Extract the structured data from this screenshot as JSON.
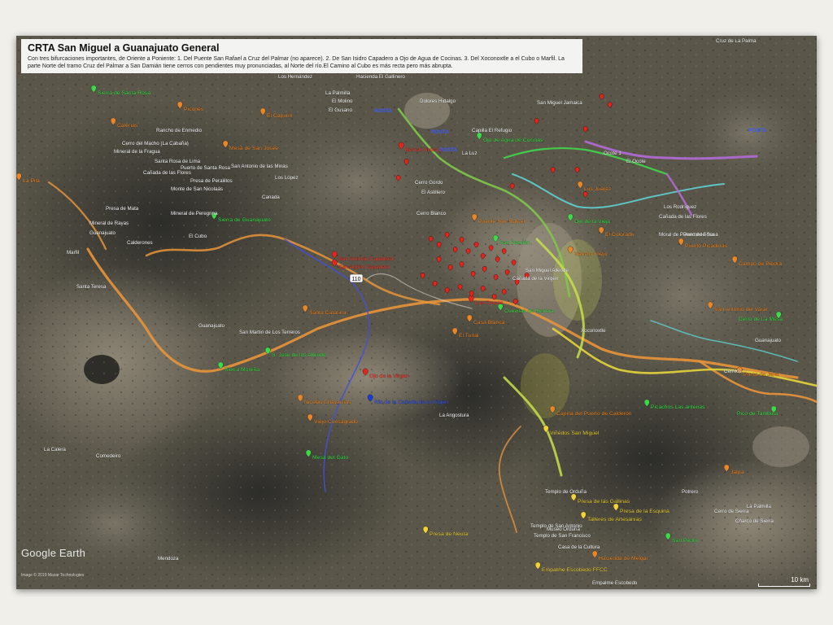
{
  "info": {
    "title": "CRTA San Miguel a Guanajuato General",
    "description": "Con tres bifurcaciones importantes, de Oriente a Poniente: 1. Del Puente San Rafael a Cruz del Palmar (no aparece). 2. De San Isidro Capadero a Ojo de Agua de Cocinas. 3. Del Xoconoxtle a el Cubo o Marfil. La parte Norte del tramo Cruz del Palmar a San Damián tiene cerros con pendientes muy pronunciadas, al Norte del río.El Camino al Cubo es más recta pero más abrupta."
  },
  "branding": {
    "logo": "Google Earth",
    "copyright": "Image © 2019 Maxar Technologies"
  },
  "scale": {
    "label": "10 km"
  },
  "colors": {
    "route_orange": "#e8943a",
    "route_yellow": "#e6d53a",
    "route_green": "#7ec84a",
    "route_cyan": "#5fd0d0",
    "route_purple": "#b36ad6",
    "route_blue": "#4450d8",
    "route_yellowgreen": "#c8e04a",
    "pin_red": "#e0261e",
    "pin_orange": "#e8862a",
    "pin_green": "#3fd84a",
    "pin_yellow": "#f0d23a",
    "pin_blue": "#1a3ad8",
    "label_red": "#ff3a2e",
    "label_orange": "#f08a2a",
    "label_green": "#3ee04a",
    "label_blue": "#3a5aff",
    "label_white": "#ffffff"
  },
  "places": [
    {
      "name": "Los Hernández",
      "c": "white"
    },
    {
      "name": "Hacienda El Gallinero",
      "c": "white"
    },
    {
      "name": "Sierra de Santa Rosa",
      "c": "green"
    },
    {
      "name": "La Palmilla",
      "c": "white"
    },
    {
      "name": "El Molino",
      "c": "white"
    },
    {
      "name": "El Gusano",
      "c": "white"
    },
    {
      "name": "Dolores Hidalgo",
      "c": "white"
    },
    {
      "name": "San Miguel Jamaica",
      "c": "white"
    },
    {
      "name": "Cruz de La Palma",
      "c": "white"
    },
    {
      "name": "Picones",
      "c": "orange"
    },
    {
      "name": "Calerías",
      "c": "orange"
    },
    {
      "name": "El Capulín",
      "c": "orange"
    },
    {
      "name": "Rancho de Enmedio",
      "c": "white"
    },
    {
      "name": "Cerro del Macho (La Cabaña)",
      "c": "white"
    },
    {
      "name": "Mineral de la Fragua",
      "c": "white"
    },
    {
      "name": "Mesa de San Josée",
      "c": "orange"
    },
    {
      "name": "Santa Rosa de Lima",
      "c": "white"
    },
    {
      "name": "Puerto de Santa Rosa",
      "c": "white"
    },
    {
      "name": "Cañada de las Flores",
      "c": "white"
    },
    {
      "name": "Presa de Peralillos",
      "c": "white"
    },
    {
      "name": "Monte de San Nicolaás",
      "c": "white"
    },
    {
      "name": "San Antonio de las Minas",
      "c": "white"
    },
    {
      "name": "Los López",
      "c": "white"
    },
    {
      "name": "Presa de Mata",
      "c": "white"
    },
    {
      "name": "Mineral de Peregrina",
      "c": "white"
    },
    {
      "name": "Sierra de Guanajuato",
      "c": "green"
    },
    {
      "name": "Canada",
      "c": "white"
    },
    {
      "name": "Mineral de Rayas",
      "c": "white"
    },
    {
      "name": "Guanajuato",
      "c": "white"
    },
    {
      "name": "El Cubo",
      "c": "white"
    },
    {
      "name": "Calderones",
      "c": "white"
    },
    {
      "name": "Marfil",
      "c": "white"
    },
    {
      "name": "Santa Teresa",
      "c": "white"
    },
    {
      "name": "La Pila",
      "c": "orange"
    },
    {
      "name": "Santa Catarina",
      "c": "orange"
    },
    {
      "name": "San Martín de Los Terreros",
      "c": "white"
    },
    {
      "name": "Guanajuato",
      "c": "white"
    },
    {
      "name": "S. José de los Allende",
      "c": "green"
    },
    {
      "name": "Sierra Moreña",
      "c": "green"
    },
    {
      "name": "Nicolás Chavarrías",
      "c": "orange"
    },
    {
      "name": "Viejo Consagrado",
      "c": "orange"
    },
    {
      "name": "Mesa del Gato",
      "c": "green"
    },
    {
      "name": "La Calera",
      "c": "white"
    },
    {
      "name": "Comedeiro",
      "c": "white"
    },
    {
      "name": "Mendoza",
      "c": "white"
    },
    {
      "name": "Puerto de Sosa",
      "c": "white"
    },
    {
      "name": "Moral de Puerto de Sosa",
      "c": "white"
    },
    {
      "name": "Los Rodríguez",
      "c": "white"
    },
    {
      "name": "Cañada de las Flores",
      "c": "white"
    },
    {
      "name": "El Colorado",
      "c": "orange"
    },
    {
      "name": "Puerto Picaduras",
      "c": "orange"
    },
    {
      "name": "Campo de Piedra",
      "c": "orange"
    },
    {
      "name": "San Antonio del Varal",
      "c": "orange"
    },
    {
      "name": "Cerro de La Mesa",
      "c": "green"
    },
    {
      "name": "Guanajuato",
      "c": "white"
    },
    {
      "name": "Presa de Jaral",
      "c": "orange"
    },
    {
      "name": "Picachos Las antenas",
      "c": "green"
    },
    {
      "name": "Pico de Tambula",
      "c": "green"
    },
    {
      "name": "Presa de las Gallinas",
      "c": "yellow"
    },
    {
      "name": "Jalpa",
      "c": "orange"
    },
    {
      "name": "Potrero",
      "c": "white"
    },
    {
      "name": "La Palmilla",
      "c": "white"
    },
    {
      "name": "Cerro de Sierra",
      "c": "white"
    },
    {
      "name": "Charco de Sierra",
      "c": "white"
    },
    {
      "name": "San Pedro",
      "c": "green"
    },
    {
      "name": "Presa de la Esquina",
      "c": "yellow"
    },
    {
      "name": "Templo de Orduña",
      "c": "white"
    },
    {
      "name": "Talleres de Artesanías",
      "c": "yellow"
    },
    {
      "name": "Museo Orduña",
      "c": "white"
    },
    {
      "name": "Templo de San Antonio",
      "c": "white"
    },
    {
      "name": "Templo de San Francisco",
      "c": "white"
    },
    {
      "name": "Casa de la Cultura",
      "c": "white"
    },
    {
      "name": "Presa de Neuta",
      "c": "yellow"
    },
    {
      "name": "Hacienda de Melgar",
      "c": "orange"
    },
    {
      "name": "Empalme Escobedo FFCC",
      "c": "yellow"
    },
    {
      "name": "Empalme Escobedo",
      "c": "white"
    },
    {
      "name": "Ojo de la Virgen",
      "c": "red"
    },
    {
      "name": "Río de la Cañada de la Virgen",
      "c": "blue"
    },
    {
      "name": "La Angostura",
      "c": "white"
    },
    {
      "name": "Viñedos San Miguel",
      "c": "yellow"
    },
    {
      "name": "Capilla del Puerto de Calderón",
      "c": "orange"
    },
    {
      "name": "San Antonio Capadero",
      "c": "red"
    },
    {
      "name": "San Antón Capadero",
      "c": "red"
    },
    {
      "name": "Ocote 1",
      "c": "white"
    },
    {
      "name": "El Ocote",
      "c": "white"
    },
    {
      "name": "Capilla El Refugio",
      "c": "white"
    },
    {
      "name": "Ojo de Agua de Cocinas",
      "c": "green"
    },
    {
      "name": "Bernal Vinícola",
      "c": "red"
    },
    {
      "name": "La Luz",
      "c": "white"
    },
    {
      "name": "Cerro Gordo",
      "c": "white"
    },
    {
      "name": "El Astillero",
      "c": "white"
    },
    {
      "name": "Cerro Blanco",
      "c": "white"
    },
    {
      "name": "Los Juárez",
      "c": "orange"
    },
    {
      "name": "Ojo de la Vieja",
      "c": "green"
    },
    {
      "name": "Rancho Viejo",
      "c": "orange"
    },
    {
      "name": "San Damián",
      "c": "green"
    },
    {
      "name": "Cañada de la Virgen",
      "c": "white"
    },
    {
      "name": "Xoconoxtle",
      "c": "white"
    },
    {
      "name": "Puente San Rafael",
      "c": "orange"
    },
    {
      "name": "Los Cruces",
      "c": "red"
    },
    {
      "name": "Cuevitas de Herrera",
      "c": "green"
    },
    {
      "name": "Casa Blanca",
      "c": "orange"
    },
    {
      "name": "El Tunal",
      "c": "orange"
    },
    {
      "name": "San Miguel Allende",
      "c": "white"
    },
    {
      "name": "Cerritos",
      "c": "white"
    }
  ],
  "route_labels": [
    {
      "name": "POSTA",
      "c": "blue"
    },
    {
      "name": "POSTA",
      "c": "blue"
    },
    {
      "name": "POSTA",
      "c": "blue"
    },
    {
      "name": "POSTA",
      "c": "blue"
    }
  ],
  "road_shield": {
    "label": "110"
  }
}
